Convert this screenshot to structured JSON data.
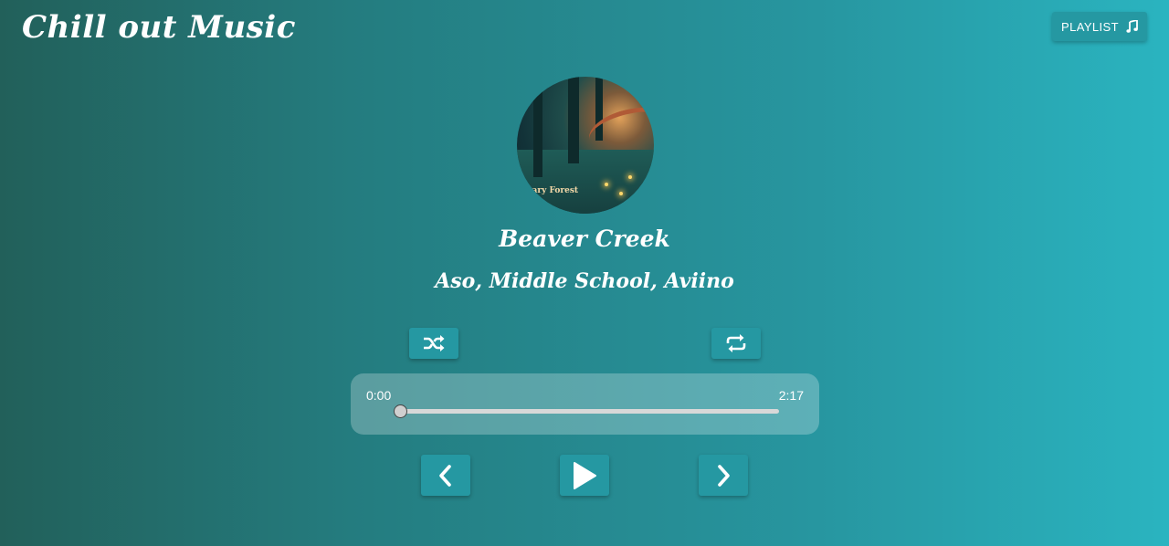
{
  "app": {
    "brand": "Chill out Music"
  },
  "header": {
    "playlist_label": "PLAYLIST",
    "playlist_icon": "music-note-icon"
  },
  "now_playing": {
    "cover_text": "nary Forest",
    "title": "Beaver Creek",
    "artist": "Aso, Middle School, Aviino"
  },
  "player": {
    "current_time": "0:00",
    "total_time": "2:17",
    "progress_fraction": 0,
    "controls": {
      "shuffle_icon": "shuffle-icon",
      "repeat_icon": "repeat-icon",
      "previous_icon": "chevron-left-icon",
      "play_icon": "play-icon",
      "next_icon": "chevron-right-icon"
    }
  },
  "colors": {
    "gradient_start": "#22605a",
    "gradient_end": "#2ab4c0",
    "button_bg": "#2598a2",
    "text": "#ffffff"
  }
}
